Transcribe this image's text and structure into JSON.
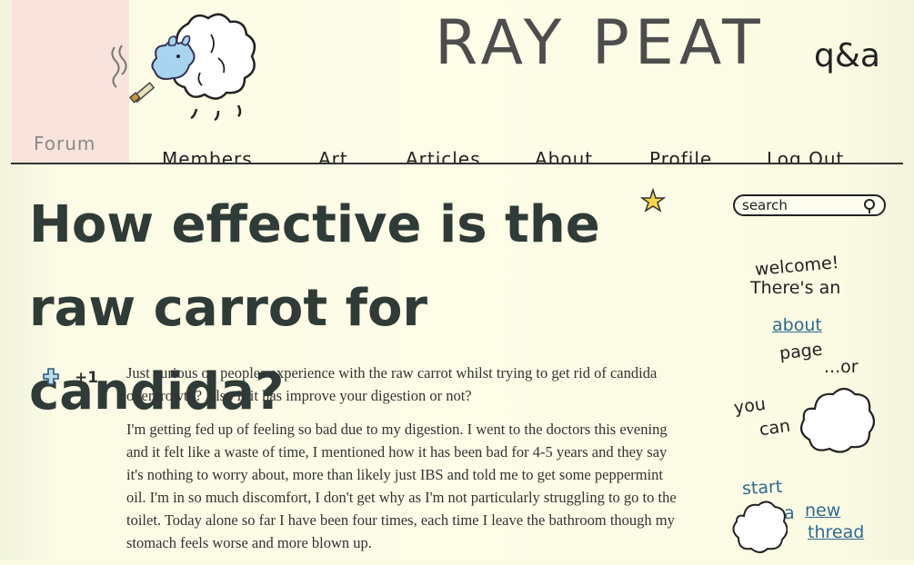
{
  "header": {
    "forum_tab": "Forum",
    "title": "RAY PEAT",
    "subtitle": "q&a"
  },
  "nav": {
    "items": [
      "Members",
      "Art",
      "Articles",
      "About",
      "Profile",
      "Log Out"
    ]
  },
  "thread": {
    "title": "How effective is the raw carrot for candida?",
    "score": "+1",
    "paragraphs": [
      "Just curious on peoples experience with the raw carrot whilst trying to get rid of candida overgrowth? Also if it has improve your digestion or not?",
      "I'm getting fed up of feeling so bad due to my digestion. I went to the doctors this evening and it felt like a waste of time, I mentioned how it has been bad for 4-5 years and they say it's nothing to worry about, more than likely just IBS and told me to get some peppermint oil. I'm in so much discomfort, I don't get why as I'm not particularly struggling to go to the toilet. Today alone so far I have been four times, each time I leave the bathroom though my stomach feels worse and more blown up."
    ]
  },
  "sidebar": {
    "search_placeholder": "search",
    "welcome_line1": "welcome!",
    "welcome_line2": "There's an",
    "about_link": "about",
    "page_word": "page",
    "or_word": "...or",
    "you_word": "you",
    "can_word": "can",
    "start_word": "start",
    "a_word": "a",
    "new_link": "new",
    "thread_link": "thread"
  }
}
